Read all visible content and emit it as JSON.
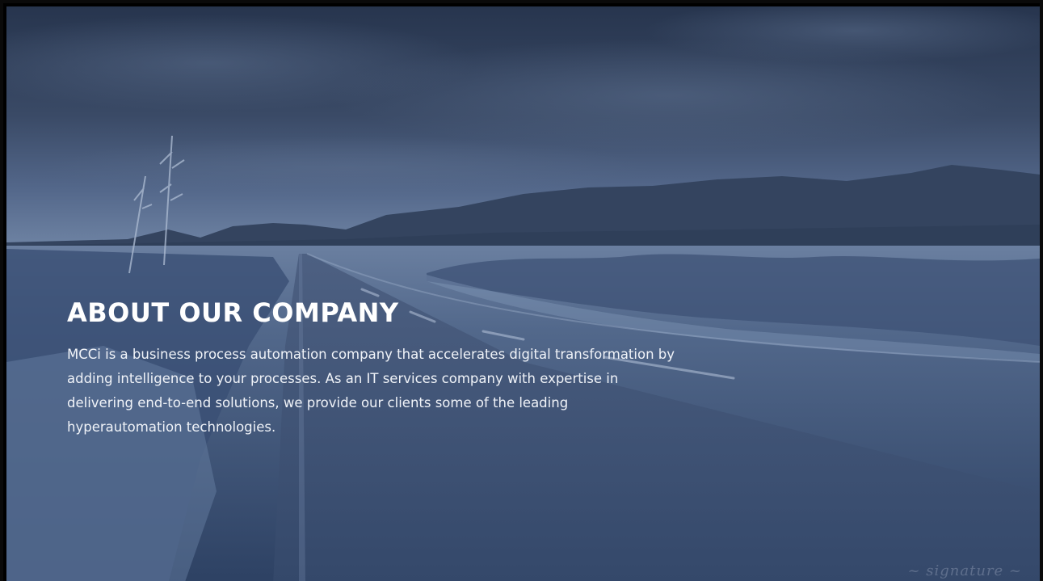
{
  "hero": {
    "title": "ABOUT OUR COMPANY",
    "description": "MCCi is a business process automation company that accelerates digital transformation by adding intelligence to your processes. As an IT services company with expertise in delivering end-to-end solutions, we provide our clients some of the leading hyperautomation technologies.",
    "background_image": "desert-highway-stormy-sky",
    "overlay_color": "#2b3f63"
  }
}
